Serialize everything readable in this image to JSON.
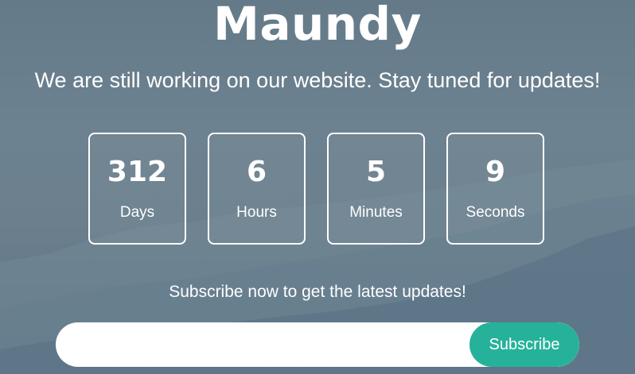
{
  "site": {
    "title": "Maundy",
    "tagline": "We are still working on our website. Stay tuned for updates!"
  },
  "countdown": [
    {
      "value": "312",
      "label": "Days"
    },
    {
      "value": "6",
      "label": "Hours"
    },
    {
      "value": "5",
      "label": "Minutes"
    },
    {
      "value": "9",
      "label": "Seconds"
    }
  ],
  "subscribe": {
    "prompt": "Subscribe now to get the latest updates!",
    "email_value": "",
    "email_placeholder": "",
    "button_label": "Subscribe"
  },
  "colors": {
    "accent": "#26b29a",
    "background": "#6b7f8d",
    "text": "#ffffff"
  }
}
